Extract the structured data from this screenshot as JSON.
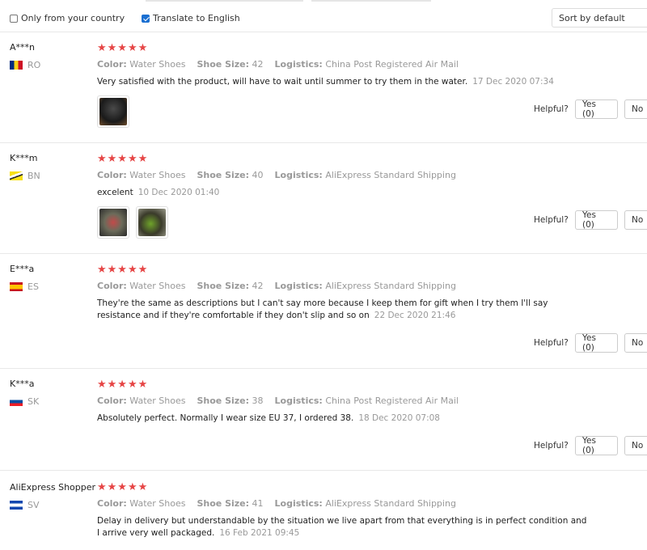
{
  "filters": {
    "only_country_label": "Only from your country",
    "only_country_checked": false,
    "translate_label": "Translate to English",
    "translate_checked": true,
    "sort_label": "Sort by default"
  },
  "labels": {
    "color": "Color:",
    "shoe_size": "Shoe Size:",
    "logistics": "Logistics:",
    "helpful": "Helpful?",
    "no": "No"
  },
  "reviews": [
    {
      "name": "A***n",
      "country": "RO",
      "stars": "★★★★★",
      "color": "Water Shoes",
      "size": "42",
      "logistics": "China Post Registered Air Mail",
      "text": "Very satisfied with the product, will have to wait until summer to try them in the water.",
      "date": "17 Dec 2020 07:34",
      "yes": "Yes (0)"
    },
    {
      "name": "K***m",
      "country": "BN",
      "stars": "★★★★★",
      "color": "Water Shoes",
      "size": "40",
      "logistics": "AliExpress Standard Shipping",
      "text": "excelent",
      "date": "10 Dec 2020 01:40",
      "yes": "Yes (0)"
    },
    {
      "name": "E***a",
      "country": "ES",
      "stars": "★★★★★",
      "color": "Water Shoes",
      "size": "42",
      "logistics": "AliExpress Standard Shipping",
      "text": "They're the same as descriptions but I can't say more because I keep them for gift when I try them I'll say resistance and if they're comfortable if they don't slip and so on",
      "date": "22 Dec 2020 21:46",
      "yes": "Yes (0)"
    },
    {
      "name": "K***a",
      "country": "SK",
      "stars": "★★★★★",
      "color": "Water Shoes",
      "size": "38",
      "logistics": "China Post Registered Air Mail",
      "text": "Absolutely perfect. Normally I wear size EU 37, I ordered 38.",
      "date": "18 Dec 2020 07:08",
      "yes": "Yes (0)"
    },
    {
      "name": "AliExpress Shopper",
      "country": "SV",
      "stars": "★★★★★",
      "color": "Water Shoes",
      "size": "41",
      "logistics": "AliExpress Standard Shipping",
      "text": "Delay in delivery but understandable by the situation we live apart from that everything is in perfect condition and I arrive very well packaged.",
      "date": "16 Feb 2021 09:45"
    }
  ],
  "colors": {
    "star": "#e64545",
    "muted": "#999999",
    "checkbox_checked": "#1b6fd1"
  }
}
